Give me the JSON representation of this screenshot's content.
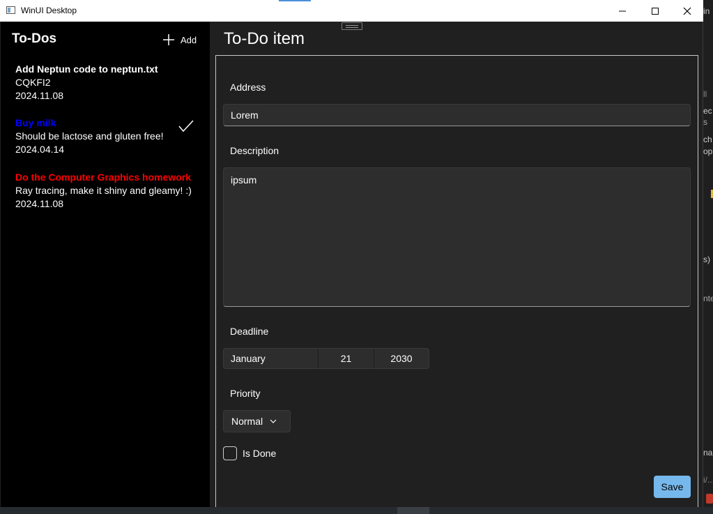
{
  "window": {
    "title": "WinUI Desktop"
  },
  "sidebar": {
    "title": "To-Dos",
    "add_label": "Add",
    "items": [
      {
        "title": "Add Neptun code to neptun.txt",
        "description": "CQKFI2",
        "date": "2024.11.08",
        "title_color": "#ffffff",
        "done": false
      },
      {
        "title": "Buy milk",
        "description": "Should be lactose and gluten free!",
        "date": "2024.04.14",
        "title_color": "#0000ff",
        "done": true
      },
      {
        "title": "Do the Computer Graphics homework",
        "description": "Ray tracing, make it shiny and gleamy! :)",
        "date": "2024.11.08",
        "title_color": "#ff0000",
        "done": false
      }
    ]
  },
  "detail": {
    "title": "To-Do item",
    "address_label": "Address",
    "address_value": "Lorem",
    "description_label": "Description",
    "description_value": "ipsum",
    "deadline_label": "Deadline",
    "deadline_month": "January",
    "deadline_day": "21",
    "deadline_year": "2030",
    "priority_label": "Priority",
    "priority_value": "Normal",
    "is_done_label": "Is Done",
    "is_done": false,
    "save_label": "Save"
  },
  "background": {
    "right_edge_fragments": [
      "in",
      "ll",
      "ec",
      "s",
      "ch",
      "op",
      "s)",
      "nte",
      "na",
      "i/..."
    ]
  },
  "colors": {
    "accent": "#77b8ec",
    "sidebar_bg": "#000000",
    "window_bg": "#202020"
  }
}
